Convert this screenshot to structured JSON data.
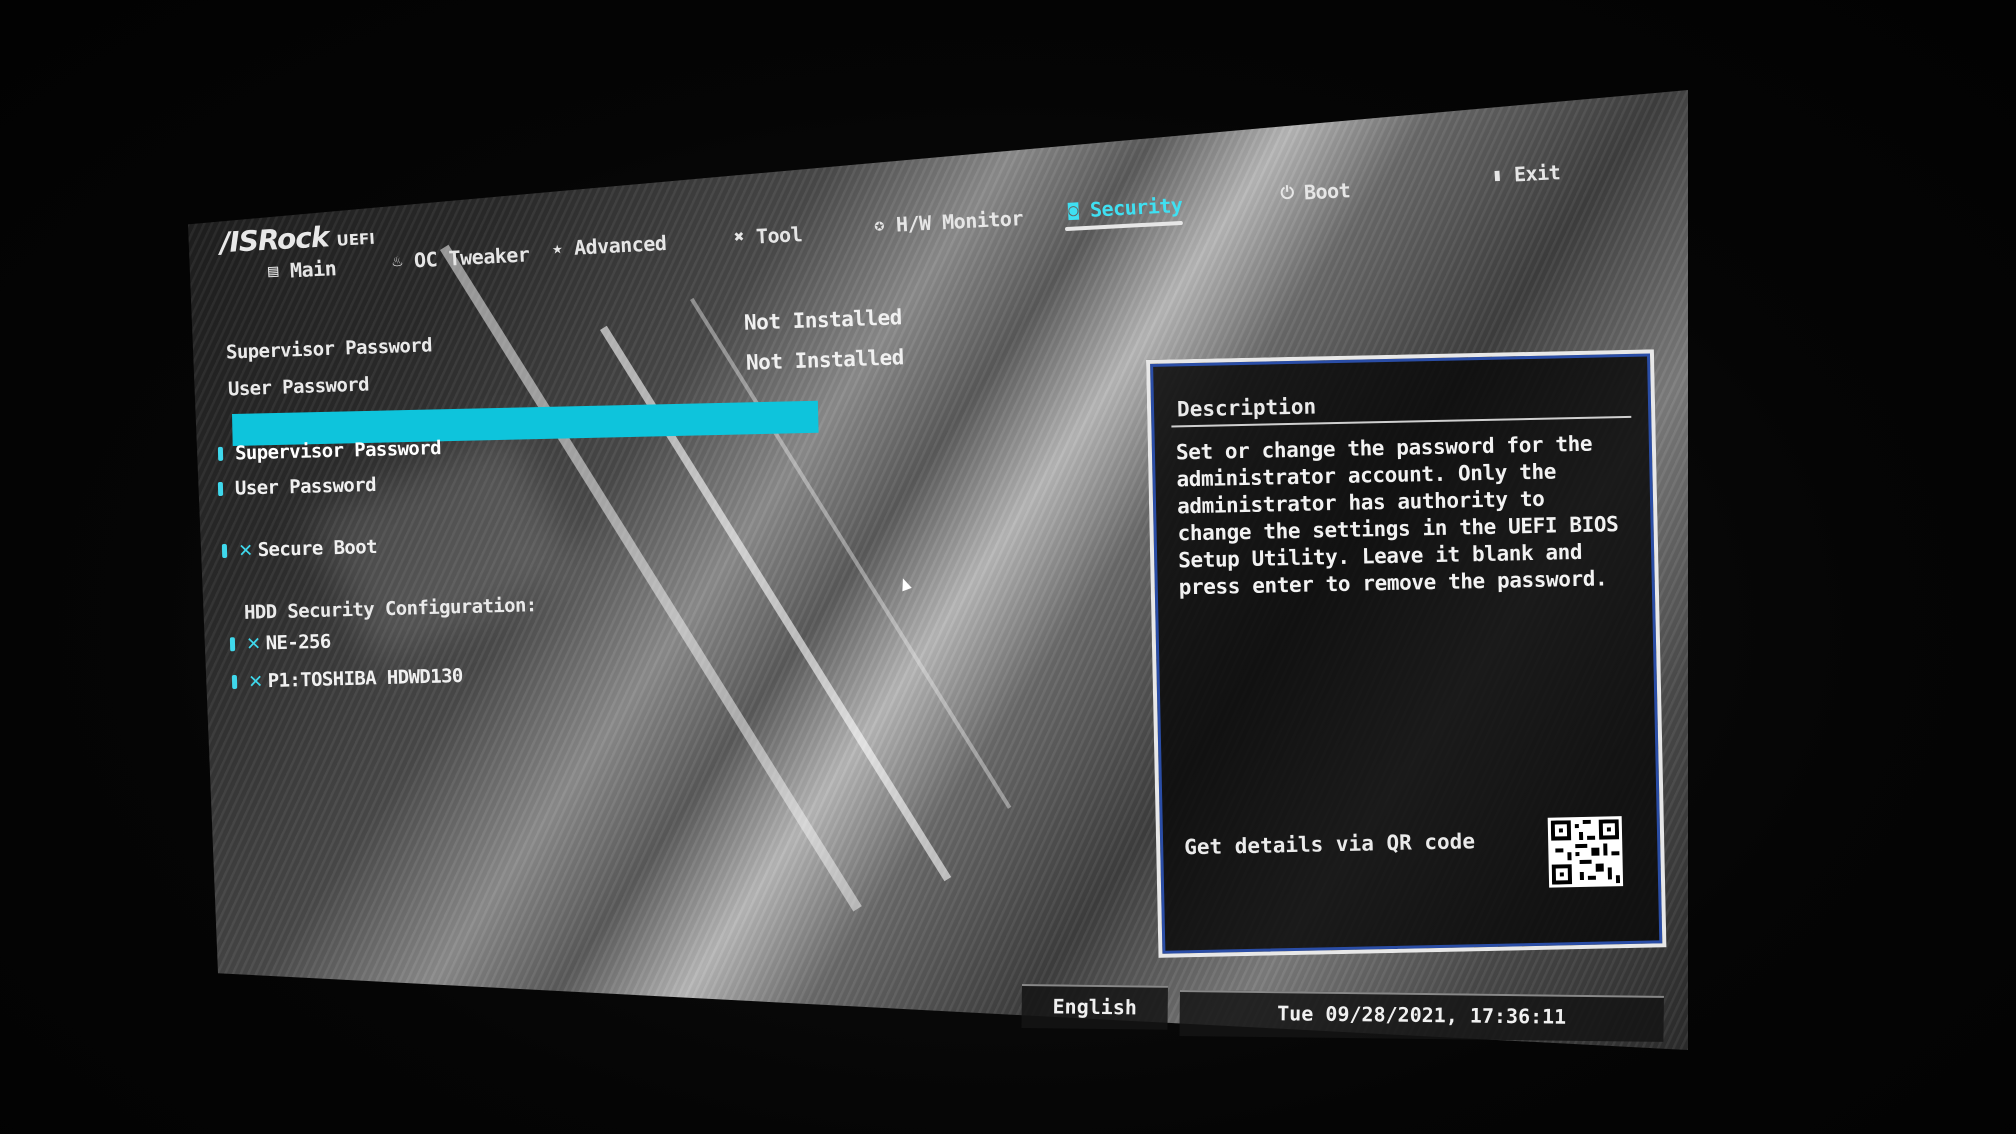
{
  "brand": {
    "name": "/ISRock",
    "sub": "UEFI"
  },
  "tabs": [
    {
      "label": "Main",
      "icon": "main-icon"
    },
    {
      "label": "OC Tweaker",
      "icon": "flame-icon"
    },
    {
      "label": "Advanced",
      "icon": "star-icon"
    },
    {
      "label": "Tool",
      "icon": "tool-icon"
    },
    {
      "label": "H/W Monitor",
      "icon": "monitor-icon"
    },
    {
      "label": "Security",
      "icon": "shield-icon",
      "active": true
    },
    {
      "label": "Boot",
      "icon": "power-icon"
    },
    {
      "label": "Exit",
      "icon": "exit-icon"
    }
  ],
  "status": {
    "supervisor_label": "Supervisor Password",
    "supervisor_value": "Not Installed",
    "user_label": "User Password",
    "user_value": "Not Installed"
  },
  "menu": {
    "supervisor_password": "Supervisor Password",
    "user_password": "User Password",
    "secure_boot": "Secure Boot",
    "hdd_heading": "HDD Security Configuration:",
    "hdd_items": [
      "NE-256",
      "P1:TOSHIBA HDWD130"
    ]
  },
  "description": {
    "title": "Description",
    "body": "Set or change the password for the administrator account. Only the administrator has authority to change the settings in the UEFI BIOS Setup Utility. Leave it blank and press enter to remove the password.",
    "qr_label": "Get details via QR code"
  },
  "footer": {
    "language": "English",
    "datetime": "Tue 09/28/2021, 17:36:11"
  },
  "colors": {
    "accent": "#0ec4dc",
    "active_tab": "#3fe0f2"
  }
}
